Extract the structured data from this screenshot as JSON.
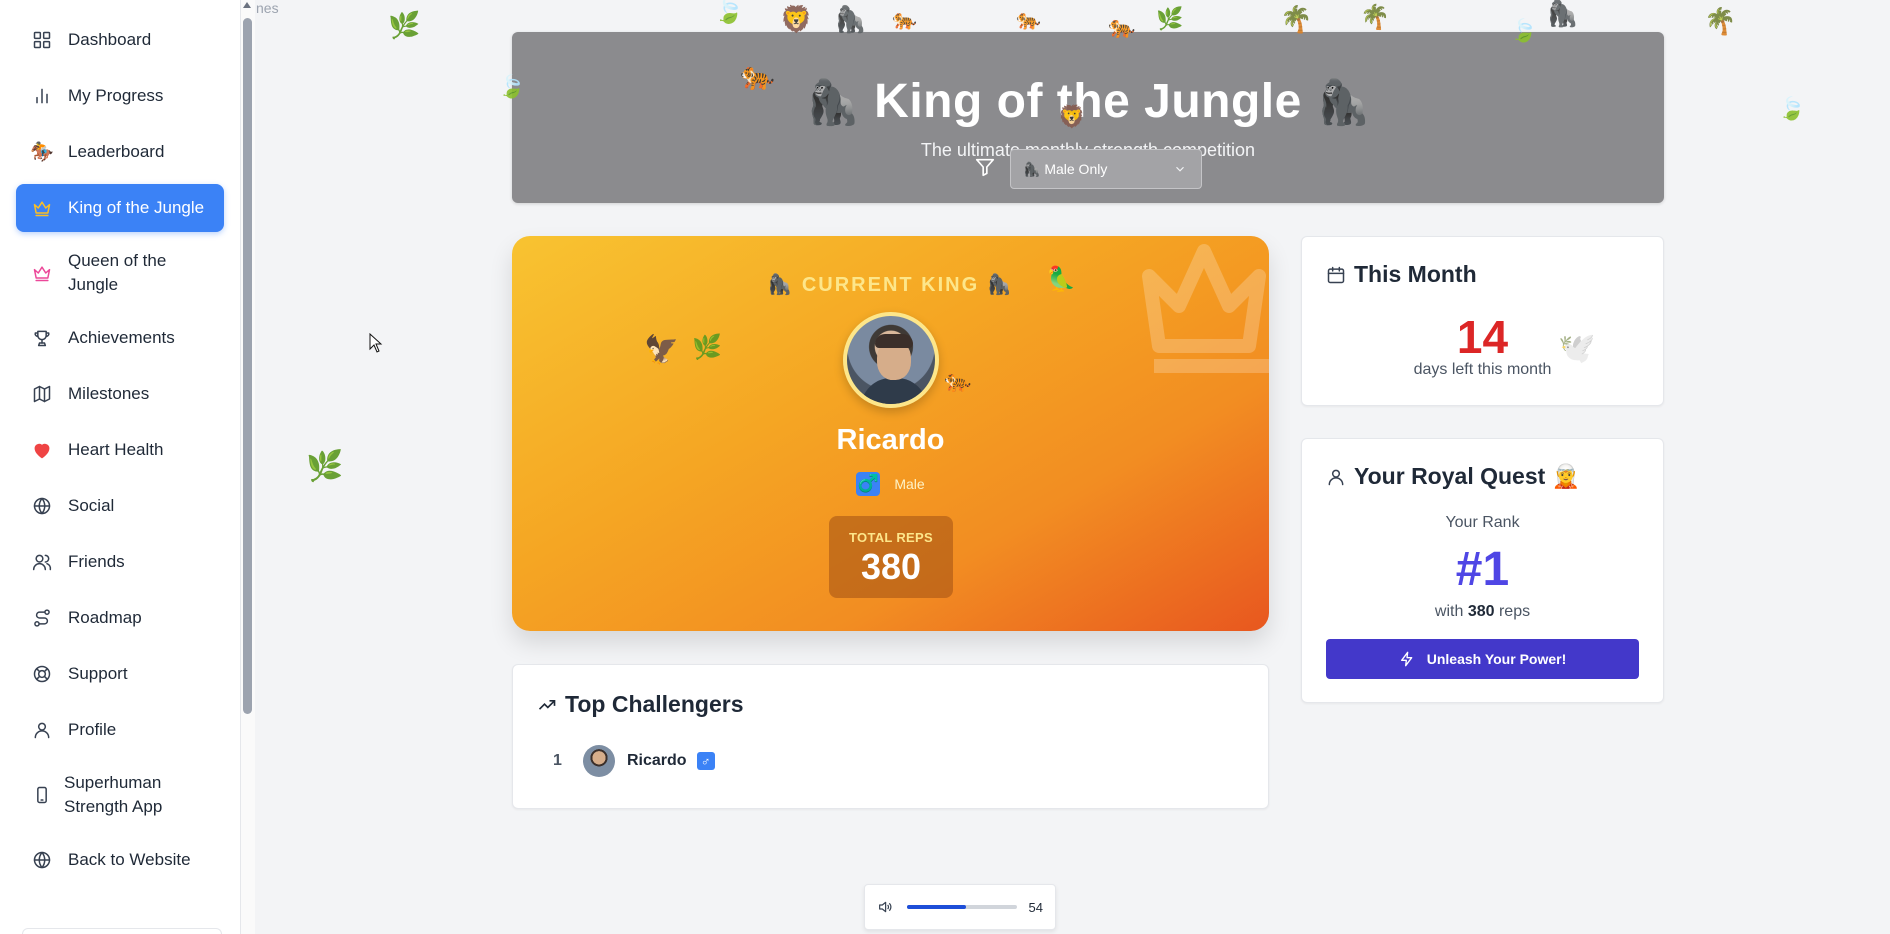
{
  "sidebar": {
    "cut_label": "nes",
    "items": [
      {
        "label": "Dashboard",
        "icon": "grid-icon"
      },
      {
        "label": "My Progress",
        "icon": "bar-chart-icon"
      },
      {
        "label": "Leaderboard",
        "icon": "monkey-rider-icon"
      },
      {
        "label": "King of the Jungle",
        "icon": "crown-icon"
      },
      {
        "label": "Queen of the Jungle",
        "icon": "crown-icon"
      },
      {
        "label": "Achievements",
        "icon": "trophy-icon"
      },
      {
        "label": "Milestones",
        "icon": "map-icon"
      },
      {
        "label": "Heart Health",
        "icon": "heart-icon"
      },
      {
        "label": "Social",
        "icon": "globe-icon"
      },
      {
        "label": "Friends",
        "icon": "users-icon"
      },
      {
        "label": "Roadmap",
        "icon": "route-icon"
      },
      {
        "label": "Support",
        "icon": "lifebuoy-icon"
      },
      {
        "label": "Profile",
        "icon": "user-icon"
      },
      {
        "label": "Superhuman Strength App",
        "icon": "smartphone-icon"
      },
      {
        "label": "Back to Website",
        "icon": "globe-icon"
      }
    ],
    "active_index": 3
  },
  "hero": {
    "title_left_emoji": "🦍",
    "title": "King of the Jungle",
    "title_right_emoji": "🦍",
    "subtitle": "The ultimate monthly strength competition",
    "filter": {
      "icon": "filter-icon",
      "selected": "🦍 Male Only"
    }
  },
  "king": {
    "heading": "🦍 CURRENT KING 🦍",
    "name": "Ricardo",
    "gender_symbol": "♂️",
    "gender": "Male",
    "reps_label": "TOTAL REPS",
    "reps": "380"
  },
  "month": {
    "title": "This Month",
    "icon": "calendar-icon",
    "days": "14",
    "days_label": "days left this month"
  },
  "quest": {
    "title": "Your Royal Quest 🧝",
    "icon": "user-icon",
    "rank_label": "Your Rank",
    "rank": "#1",
    "reps_prefix": "with",
    "reps": "380",
    "reps_suffix": "reps",
    "button": "Unleash Your Power!"
  },
  "challengers": {
    "title": "Top Challengers",
    "icon": "trending-up-icon",
    "rows": [
      {
        "rank": "1",
        "name": "Ricardo",
        "gender_symbol": "♂"
      }
    ]
  },
  "volume": {
    "icon": "speaker-icon",
    "level": 54,
    "value": "54"
  },
  "colors": {
    "active_nav": "#3b82f6",
    "king_gradient_start": "#f8c331",
    "king_gradient_end": "#e8571f",
    "days_red": "#dc2626",
    "rank_indigo": "#4f46e5",
    "button_indigo": "#4338ca"
  }
}
